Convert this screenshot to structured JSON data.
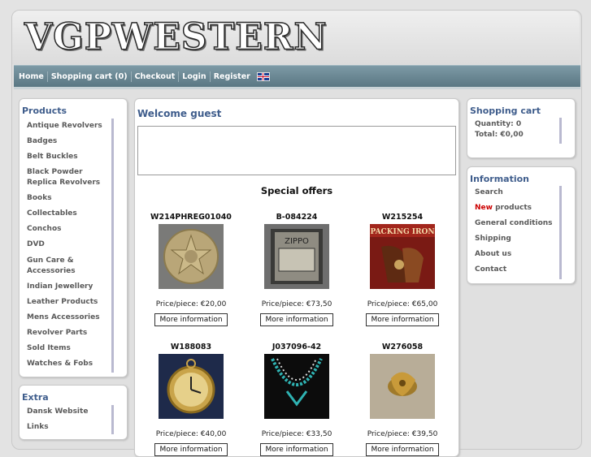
{
  "site": {
    "logo": "VGPWESTERN"
  },
  "nav": {
    "items": [
      "Home",
      "Shopping cart (0)",
      "Checkout",
      "Login",
      "Register"
    ],
    "flag": "uk-flag-icon"
  },
  "products_box": {
    "title": "Products",
    "items": [
      "Antique Revolvers",
      "Badges",
      "Belt Buckles",
      "Black Powder Replica Revolvers",
      "Books",
      "Collectables",
      "Conchos",
      "DVD",
      "Gun Care & Accessories",
      "Indian Jewellery",
      "Leather Products",
      "Mens Accessories",
      "Revolver Parts",
      "Sold Items",
      "Watches & Fobs"
    ]
  },
  "extra_box": {
    "title": "Extra",
    "items": [
      "Dansk Website",
      "Links"
    ]
  },
  "main": {
    "welcome": "Welcome guest",
    "special_offers": "Special offers"
  },
  "products": [
    {
      "code": "W214PHREG01040",
      "price": "Price/piece: €20,00",
      "button": "More information",
      "image": "regulator-badge-image"
    },
    {
      "code": "B-084224",
      "price": "Price/piece: €73,50",
      "button": "More information",
      "image": "zippo-lighter-image"
    },
    {
      "code": "W215254",
      "price": "Price/piece: €65,00",
      "button": "More information",
      "image": "packing-iron-book-image"
    },
    {
      "code": "W188083",
      "price": "Price/piece: €40,00",
      "button": "More information",
      "image": "pocket-watch-image"
    },
    {
      "code": "J037096-42",
      "price": "Price/piece: €33,50",
      "button": "More information",
      "image": "turquoise-necklace-image"
    },
    {
      "code": "W276058",
      "price": "Price/piece: €39,50",
      "button": "More information",
      "image": "brass-ornament-image"
    }
  ],
  "cart_box": {
    "title": "Shopping cart",
    "quantity": "Quantity: 0",
    "total": "Total: €0,00"
  },
  "info_box": {
    "title": "Information",
    "items": [
      "Search",
      "products",
      "General conditions",
      "Shipping",
      "About us",
      "Contact"
    ],
    "new_label": "New"
  },
  "colors": {
    "nav": "#6b8793",
    "title": "#3f5d8c",
    "new": "#cc0000"
  }
}
